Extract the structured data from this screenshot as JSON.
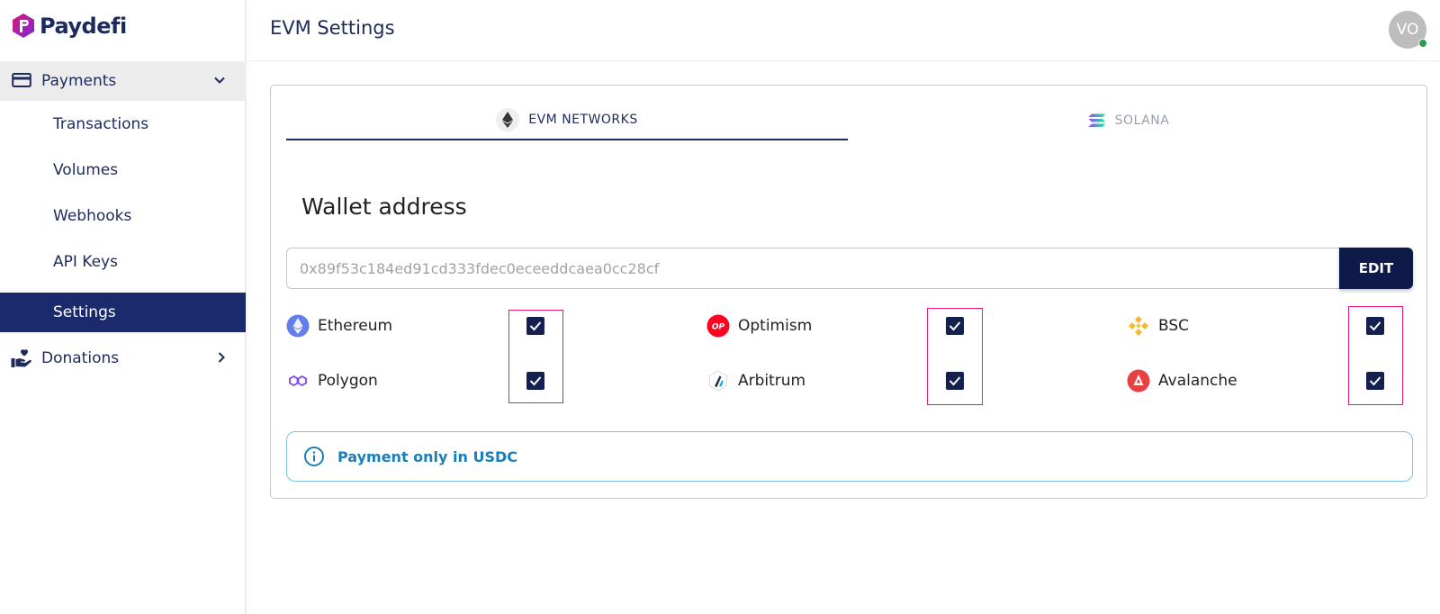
{
  "app": {
    "name": "Paydefi"
  },
  "sidebar": {
    "payments_label": "Payments",
    "sub_items": [
      {
        "label": "Transactions"
      },
      {
        "label": "Volumes"
      },
      {
        "label": "Webhooks"
      },
      {
        "label": "API Keys"
      },
      {
        "label": "Settings",
        "active": true
      }
    ],
    "donations_label": "Donations"
  },
  "header": {
    "title": "EVM Settings",
    "avatar_initials": "VO",
    "online_status_color": "#2e9e47"
  },
  "tabs": [
    {
      "label": "EVM NETWORKS",
      "icon": "ethereum-icon",
      "active": true
    },
    {
      "label": "SOLANA",
      "icon": "solana-icon",
      "active": false
    }
  ],
  "wallet": {
    "title": "Wallet address",
    "address_placeholder": "0x89f53c184ed91cd333fdec0eceeddcaea0cc28cf",
    "edit_label": "EDIT"
  },
  "networks": [
    {
      "name": "Ethereum",
      "icon": "ethereum-icon",
      "checked": true
    },
    {
      "name": "Optimism",
      "icon": "optimism-icon",
      "checked": true
    },
    {
      "name": "BSC",
      "icon": "bsc-icon",
      "checked": true
    },
    {
      "name": "Polygon",
      "icon": "polygon-icon",
      "checked": true
    },
    {
      "name": "Arbitrum",
      "icon": "arbitrum-icon",
      "checked": true
    },
    {
      "name": "Avalanche",
      "icon": "avalanche-icon",
      "checked": true
    }
  ],
  "info": {
    "text": "Payment only in USDC"
  },
  "colors": {
    "brand_navy": "#1a2a6c",
    "highlight": "#e8197a",
    "info_blue": "#1a7fb8"
  }
}
